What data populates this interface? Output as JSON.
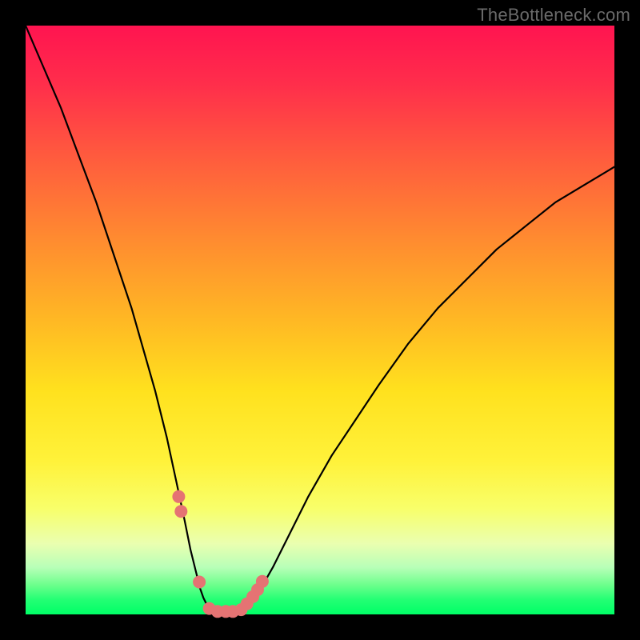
{
  "watermark": {
    "text": "TheBottleneck.com"
  },
  "chart_data": {
    "type": "line",
    "title": "",
    "xlabel": "",
    "ylabel": "",
    "xlim": [
      0,
      100
    ],
    "ylim": [
      0,
      100
    ],
    "grid": false,
    "legend": false,
    "background": "rainbow-vertical-gradient",
    "series": [
      {
        "name": "left-branch",
        "x": [
          0,
          3,
          6,
          9,
          12,
          15,
          18,
          20,
          22,
          24,
          25.5,
          27,
          28,
          29,
          29.6,
          30.2,
          30.8,
          31.4
        ],
        "y": [
          100,
          93,
          86,
          78,
          70,
          61,
          52,
          45,
          38,
          30,
          23,
          16,
          11,
          7,
          4.5,
          2.8,
          1.6,
          0.8
        ]
      },
      {
        "name": "valley-floor",
        "x": [
          31.4,
          32.5,
          34.0,
          35.5,
          37.0
        ],
        "y": [
          0.8,
          0.5,
          0.4,
          0.5,
          0.8
        ]
      },
      {
        "name": "right-branch",
        "x": [
          37.0,
          38.5,
          40,
          42,
          45,
          48,
          52,
          56,
          60,
          65,
          70,
          75,
          80,
          85,
          90,
          95,
          100
        ],
        "y": [
          0.8,
          2.0,
          4.5,
          8,
          14,
          20,
          27,
          33,
          39,
          46,
          52,
          57,
          62,
          66,
          70,
          73,
          76
        ]
      }
    ],
    "points": {
      "name": "highlighted-dots",
      "color": "#e57373",
      "x": [
        26.0,
        26.4,
        29.5,
        31.2,
        32.6,
        34.0,
        35.2,
        36.6,
        37.6,
        38.6,
        39.4,
        40.2
      ],
      "y": [
        20.0,
        17.5,
        5.5,
        1.0,
        0.5,
        0.5,
        0.5,
        0.8,
        1.8,
        3.0,
        4.2,
        5.6
      ]
    }
  }
}
